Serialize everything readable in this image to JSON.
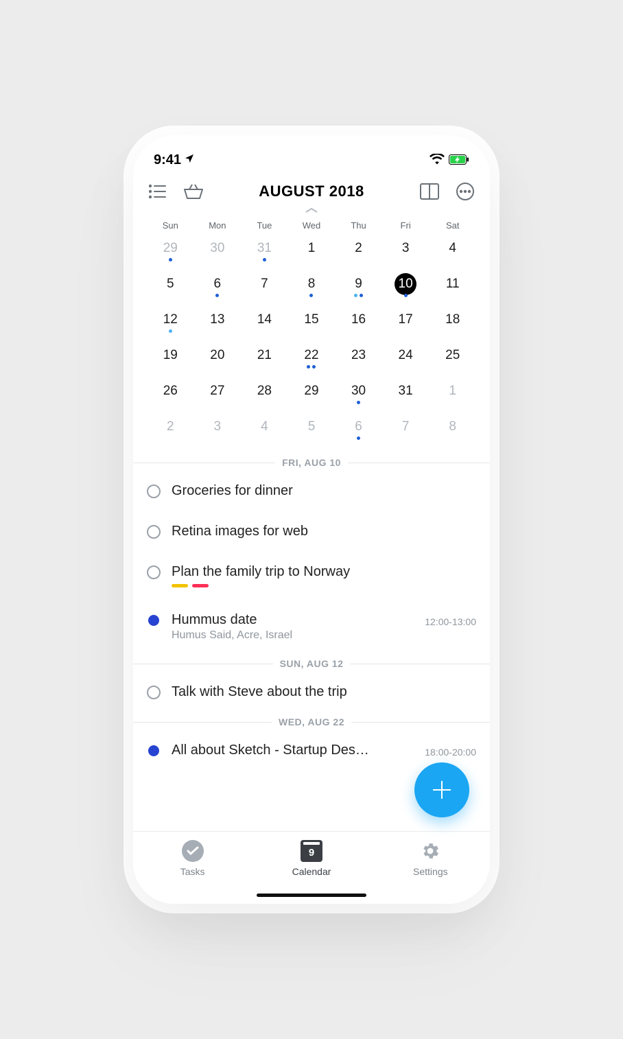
{
  "status": {
    "time": "9:41"
  },
  "toolbar": {
    "title": "AUGUST 2018"
  },
  "weekdays": [
    "Sun",
    "Mon",
    "Tue",
    "Wed",
    "Thu",
    "Fri",
    "Sat"
  ],
  "days": [
    {
      "n": "29",
      "out": true,
      "dots": [
        "blue"
      ]
    },
    {
      "n": "30",
      "out": true
    },
    {
      "n": "31",
      "out": true,
      "dots": [
        "blue"
      ]
    },
    {
      "n": "1"
    },
    {
      "n": "2"
    },
    {
      "n": "3"
    },
    {
      "n": "4"
    },
    {
      "n": "5"
    },
    {
      "n": "6",
      "dots": [
        "blue"
      ]
    },
    {
      "n": "7"
    },
    {
      "n": "8",
      "dots": [
        "blue"
      ]
    },
    {
      "n": "9",
      "dots": [
        "light",
        "blue"
      ]
    },
    {
      "n": "10",
      "sel": true,
      "dots": [
        "blue"
      ]
    },
    {
      "n": "11"
    },
    {
      "n": "12",
      "dots": [
        "light"
      ]
    },
    {
      "n": "13"
    },
    {
      "n": "14"
    },
    {
      "n": "15"
    },
    {
      "n": "16"
    },
    {
      "n": "17"
    },
    {
      "n": "18"
    },
    {
      "n": "19"
    },
    {
      "n": "20"
    },
    {
      "n": "21"
    },
    {
      "n": "22",
      "dots": [
        "blue",
        "blue"
      ]
    },
    {
      "n": "23"
    },
    {
      "n": "24"
    },
    {
      "n": "25"
    },
    {
      "n": "26"
    },
    {
      "n": "27"
    },
    {
      "n": "28"
    },
    {
      "n": "29"
    },
    {
      "n": "30",
      "dots": [
        "blue"
      ]
    },
    {
      "n": "31"
    },
    {
      "n": "1",
      "out": true
    },
    {
      "n": "2",
      "out": true
    },
    {
      "n": "3",
      "out": true
    },
    {
      "n": "4",
      "out": true
    },
    {
      "n": "5",
      "out": true
    },
    {
      "n": "6",
      "out": true,
      "dots": [
        "blue"
      ]
    },
    {
      "n": "7",
      "out": true
    },
    {
      "n": "8",
      "out": true
    }
  ],
  "sections": [
    {
      "label": "FRI, AUG 10",
      "items": [
        {
          "kind": "task",
          "title": "Groceries for dinner"
        },
        {
          "kind": "task",
          "title": "Retina images for web"
        },
        {
          "kind": "task",
          "title": "Plan the family trip to Norway",
          "tags": [
            "yellow",
            "red"
          ]
        },
        {
          "kind": "event",
          "title": "Hummus date",
          "sub": "Humus Said, Acre, Israel",
          "time": "12:00-13:00"
        }
      ]
    },
    {
      "label": "SUN, AUG 12",
      "items": [
        {
          "kind": "task",
          "title": "Talk with Steve about the trip"
        }
      ]
    },
    {
      "label": "WED, AUG 22",
      "items": [
        {
          "kind": "event",
          "title": "All about Sketch - Startup Des…",
          "time": "18:00-20:00"
        }
      ]
    }
  ],
  "tabs": {
    "tasks": "Tasks",
    "calendar": "Calendar",
    "calendar_day": "9",
    "settings": "Settings"
  }
}
